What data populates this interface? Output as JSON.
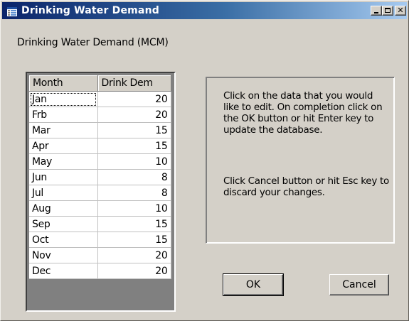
{
  "window": {
    "title": "Drinking Water Demand",
    "icon": "app-table-icon",
    "controls": {
      "minimize": "minimize-icon",
      "maximize": "maximize-icon",
      "close": "close-icon"
    }
  },
  "caption": "Drinking Water Demand (MCM)",
  "grid": {
    "headers": [
      "Month",
      "Drink Dem"
    ],
    "rows": [
      [
        "Jan",
        "20"
      ],
      [
        "Frb",
        "20"
      ],
      [
        "Mar",
        "15"
      ],
      [
        "Apr",
        "15"
      ],
      [
        "May",
        "10"
      ],
      [
        "Jun",
        "8"
      ],
      [
        "Jul",
        "8"
      ],
      [
        "Aug",
        "10"
      ],
      [
        "Sep",
        "15"
      ],
      [
        "Oct",
        "15"
      ],
      [
        "Nov",
        "20"
      ],
      [
        "Dec",
        "20"
      ]
    ]
  },
  "info": {
    "paragraph1": "Click on the data that you would like to edit. On completion click on the OK button or hit Enter key to update the database.",
    "paragraph2": "Click Cancel button or hit Esc key to discard your changes."
  },
  "buttons": {
    "ok": "OK",
    "cancel": "Cancel"
  },
  "colors": {
    "titlebar_start": "#0a246a",
    "titlebar_end": "#a6caf0",
    "dialog_face": "#d4d0c8"
  }
}
